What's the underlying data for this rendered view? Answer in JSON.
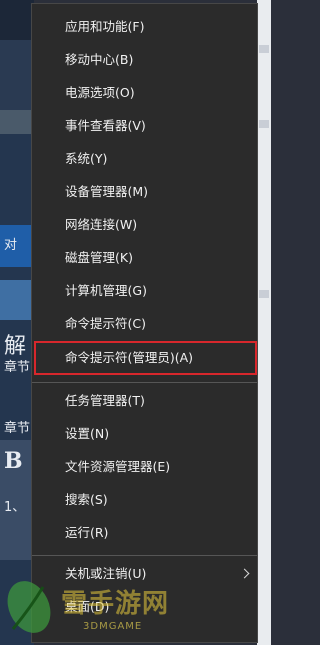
{
  "menu": {
    "items": [
      {
        "label": "应用和功能(F)"
      },
      {
        "label": "移动中心(B)"
      },
      {
        "label": "电源选项(O)"
      },
      {
        "label": "事件查看器(V)"
      },
      {
        "label": "系统(Y)"
      },
      {
        "label": "设备管理器(M)"
      },
      {
        "label": "网络连接(W)"
      },
      {
        "label": "磁盘管理(K)"
      },
      {
        "label": "计算机管理(G)"
      },
      {
        "label": "命令提示符(C)"
      },
      {
        "label": "命令提示符(管理员)(A)"
      },
      {
        "label": "任务管理器(T)"
      },
      {
        "label": "设置(N)"
      },
      {
        "label": "文件资源管理器(E)"
      },
      {
        "label": "搜索(S)"
      },
      {
        "label": "运行(R)"
      },
      {
        "label": "关机或注销(U)"
      },
      {
        "label": "桌面(D)"
      }
    ]
  },
  "background": {
    "left_texts": [
      "对",
      "解",
      "章节",
      "章节",
      "B",
      "1、"
    ],
    "accent_color": "#d8272c"
  },
  "watermark": {
    "main": "雪手游网",
    "sub": "3DMGAME"
  }
}
